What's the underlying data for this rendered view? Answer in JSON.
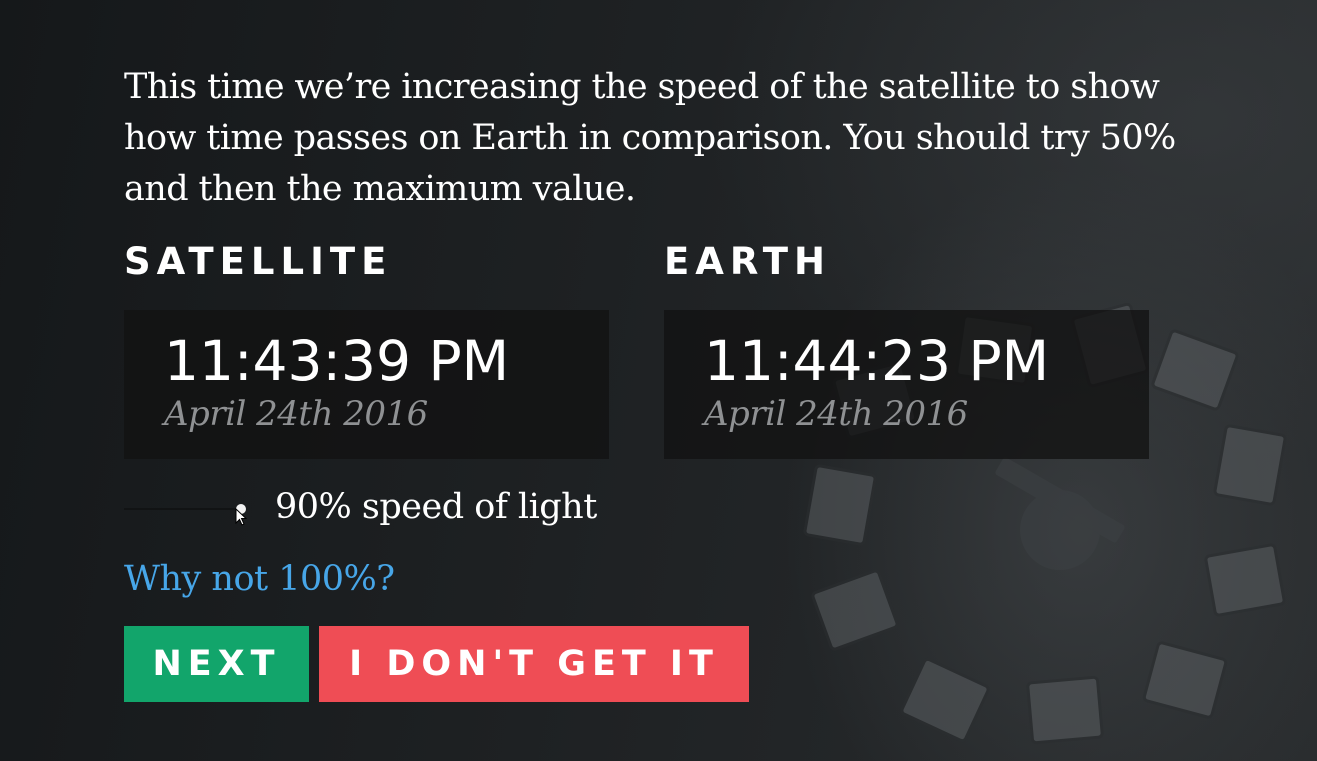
{
  "intro_text": "This time we’re increasing the speed of the satellite to show how time passes on Earth in comparison. You should try 50% and then the maximum value.",
  "satellite": {
    "label": "SATELLITE",
    "time": "11:43:39 PM",
    "date": "April 24th 2016"
  },
  "earth": {
    "label": "EARTH",
    "time": "11:44:23 PM",
    "date": "April 24th 2016"
  },
  "speed": {
    "value_percent": 90,
    "label": "90% speed of light"
  },
  "why_link": "Why not 100%?",
  "buttons": {
    "next": "NEXT",
    "help": "I DON'T GET IT"
  },
  "colors": {
    "next_button": "#12a56b",
    "help_button": "#ef4d55",
    "link": "#47a6e8"
  }
}
